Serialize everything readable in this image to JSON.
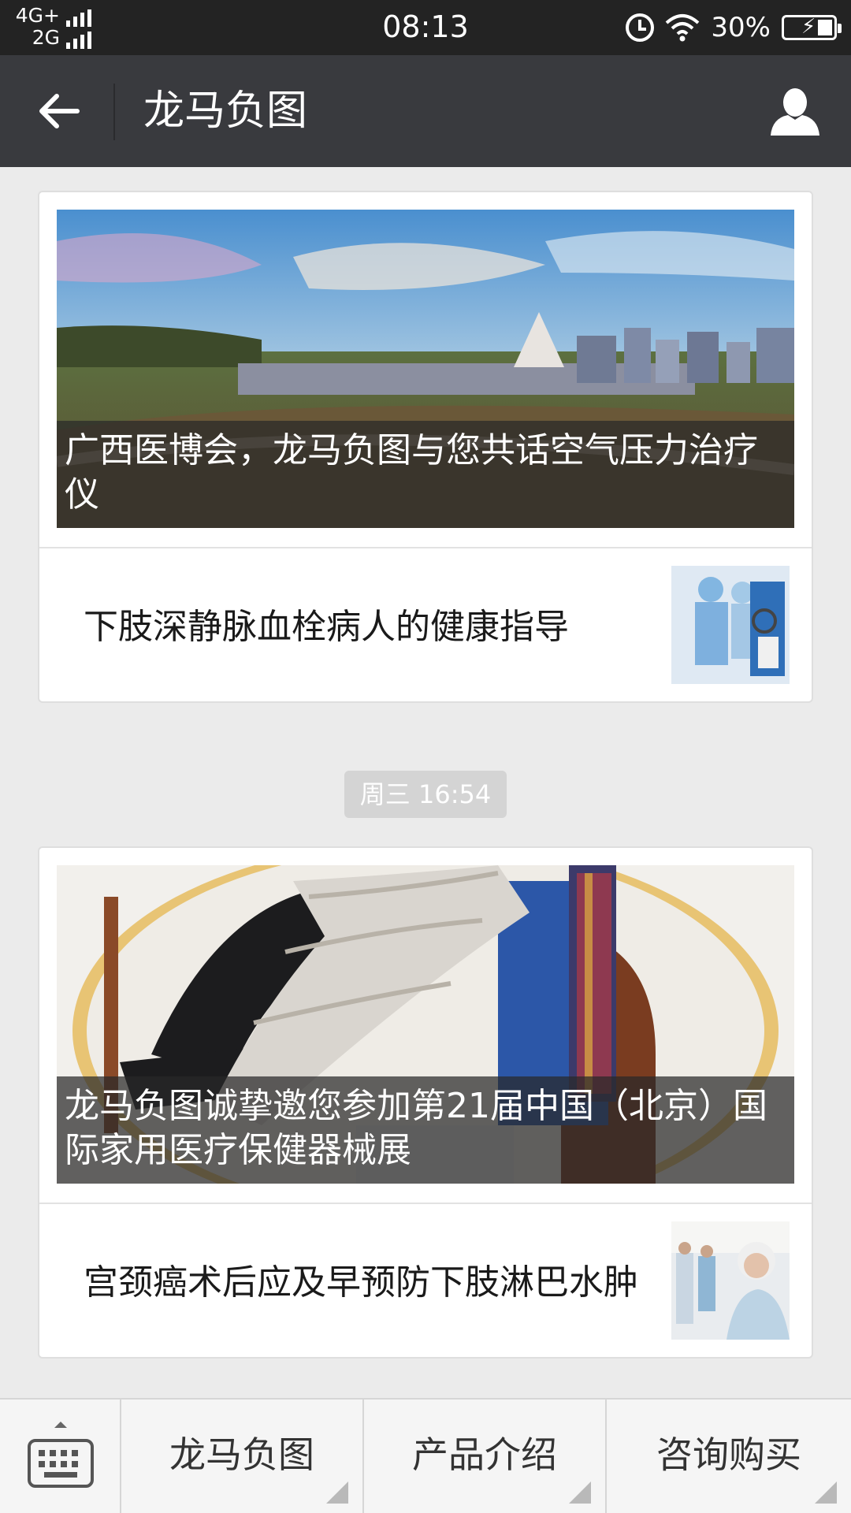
{
  "status_bar": {
    "network_top": "4G+",
    "network_bottom": "2G",
    "time": "08:13",
    "battery": "30%"
  },
  "header": {
    "title": "龙马负图",
    "back_icon": "arrow-left-icon",
    "profile_icon": "person-icon"
  },
  "messages": [
    {
      "cover_caption": "广西医博会，龙马负图与您共话空气压力治疗仪",
      "item_title": "下肢深静脉血栓病人的健康指导"
    },
    {
      "timestamp": "周三 16:54",
      "cover_caption": "龙马负图诚挚邀您参加第21届中国（北京）国际家用医疗保健器械展",
      "item_title": "宫颈癌术后应及早预防下肢淋巴水肿"
    }
  ],
  "menu": {
    "keyboard_icon": "keyboard-icon",
    "items": [
      "龙马负图",
      "产品介绍",
      "咨询购买"
    ]
  }
}
